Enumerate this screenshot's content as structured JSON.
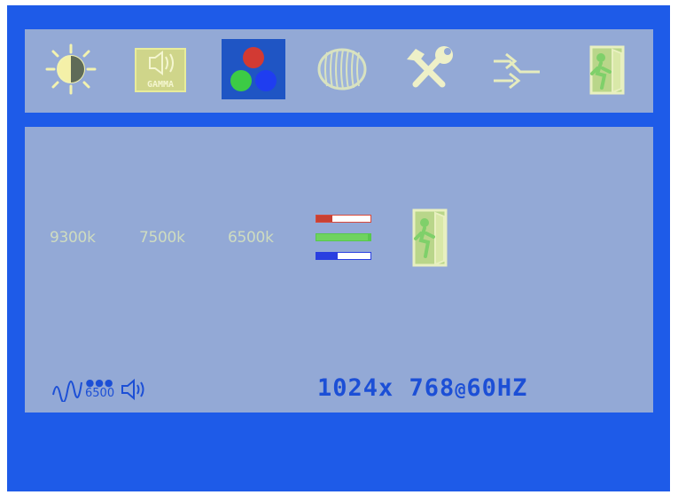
{
  "osd": {
    "menu_icons": [
      {
        "name": "brightness-contrast-icon"
      },
      {
        "name": "gamma-icon",
        "label": "GAMMA"
      },
      {
        "name": "color-icon",
        "selected": true
      },
      {
        "name": "image-icon"
      },
      {
        "name": "tools-icon"
      },
      {
        "name": "input-select-icon"
      },
      {
        "name": "exit-icon"
      }
    ],
    "color_temps": [
      "9300k",
      "7500k",
      "6500k"
    ],
    "rgb_levels": {
      "red": 0.3,
      "green": 0.95,
      "blue": 0.4
    },
    "status": {
      "preset_value": "6500",
      "volume_icon": "speaker-icon"
    },
    "resolution": {
      "main": "1024x 768",
      "at": "@",
      "refresh": "60HZ"
    },
    "colors": {
      "accent": "#1c4fd6",
      "panel": "#93a9d6",
      "frame": "#1e5be8"
    }
  }
}
